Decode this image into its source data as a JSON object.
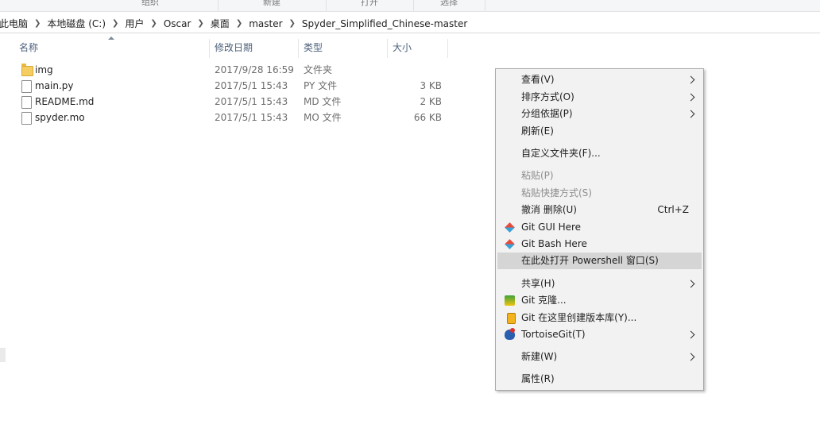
{
  "ribbon": {
    "groups": [
      "组织",
      "新建",
      "打开",
      "选择"
    ]
  },
  "breadcrumb": [
    "此电脑",
    "本地磁盘 (C:)",
    "用户",
    "Oscar",
    "桌面",
    "master",
    "Spyder_Simplified_Chinese-master"
  ],
  "columns": {
    "name": "名称",
    "date": "修改日期",
    "type": "类型",
    "size": "大小"
  },
  "files": [
    {
      "name": "img",
      "date": "2017/9/28 16:59",
      "type": "文件夹",
      "size": "",
      "icon": "folder-icon"
    },
    {
      "name": "main.py",
      "date": "2017/5/1 15:43",
      "type": "PY 文件",
      "size": "3 KB",
      "icon": "file-icon"
    },
    {
      "name": "README.md",
      "date": "2017/5/1 15:43",
      "type": "MD 文件",
      "size": "2 KB",
      "icon": "file-icon"
    },
    {
      "name": "spyder.mo",
      "date": "2017/5/1 15:43",
      "type": "MO 文件",
      "size": "66 KB",
      "icon": "file-icon"
    }
  ],
  "context_menu": {
    "view": "查看(V)",
    "sort": "排序方式(O)",
    "group": "分组依据(P)",
    "refresh": "刷新(E)",
    "customize": "自定义文件夹(F)...",
    "paste": "粘贴(P)",
    "paste_shortcut": "粘贴快捷方式(S)",
    "undo_delete": "撤消 删除(U)",
    "undo_shortcut": "Ctrl+Z",
    "git_gui": "Git GUI Here",
    "git_bash": "Git Bash Here",
    "powershell": "在此处打开 Powershell 窗口(S)",
    "share": "共享(H)",
    "git_clone": "Git 克隆...",
    "git_create_repo": "Git 在这里创建版本库(Y)...",
    "tortoisegit": "TortoiseGit(T)",
    "new": "新建(W)",
    "properties": "属性(R)"
  }
}
